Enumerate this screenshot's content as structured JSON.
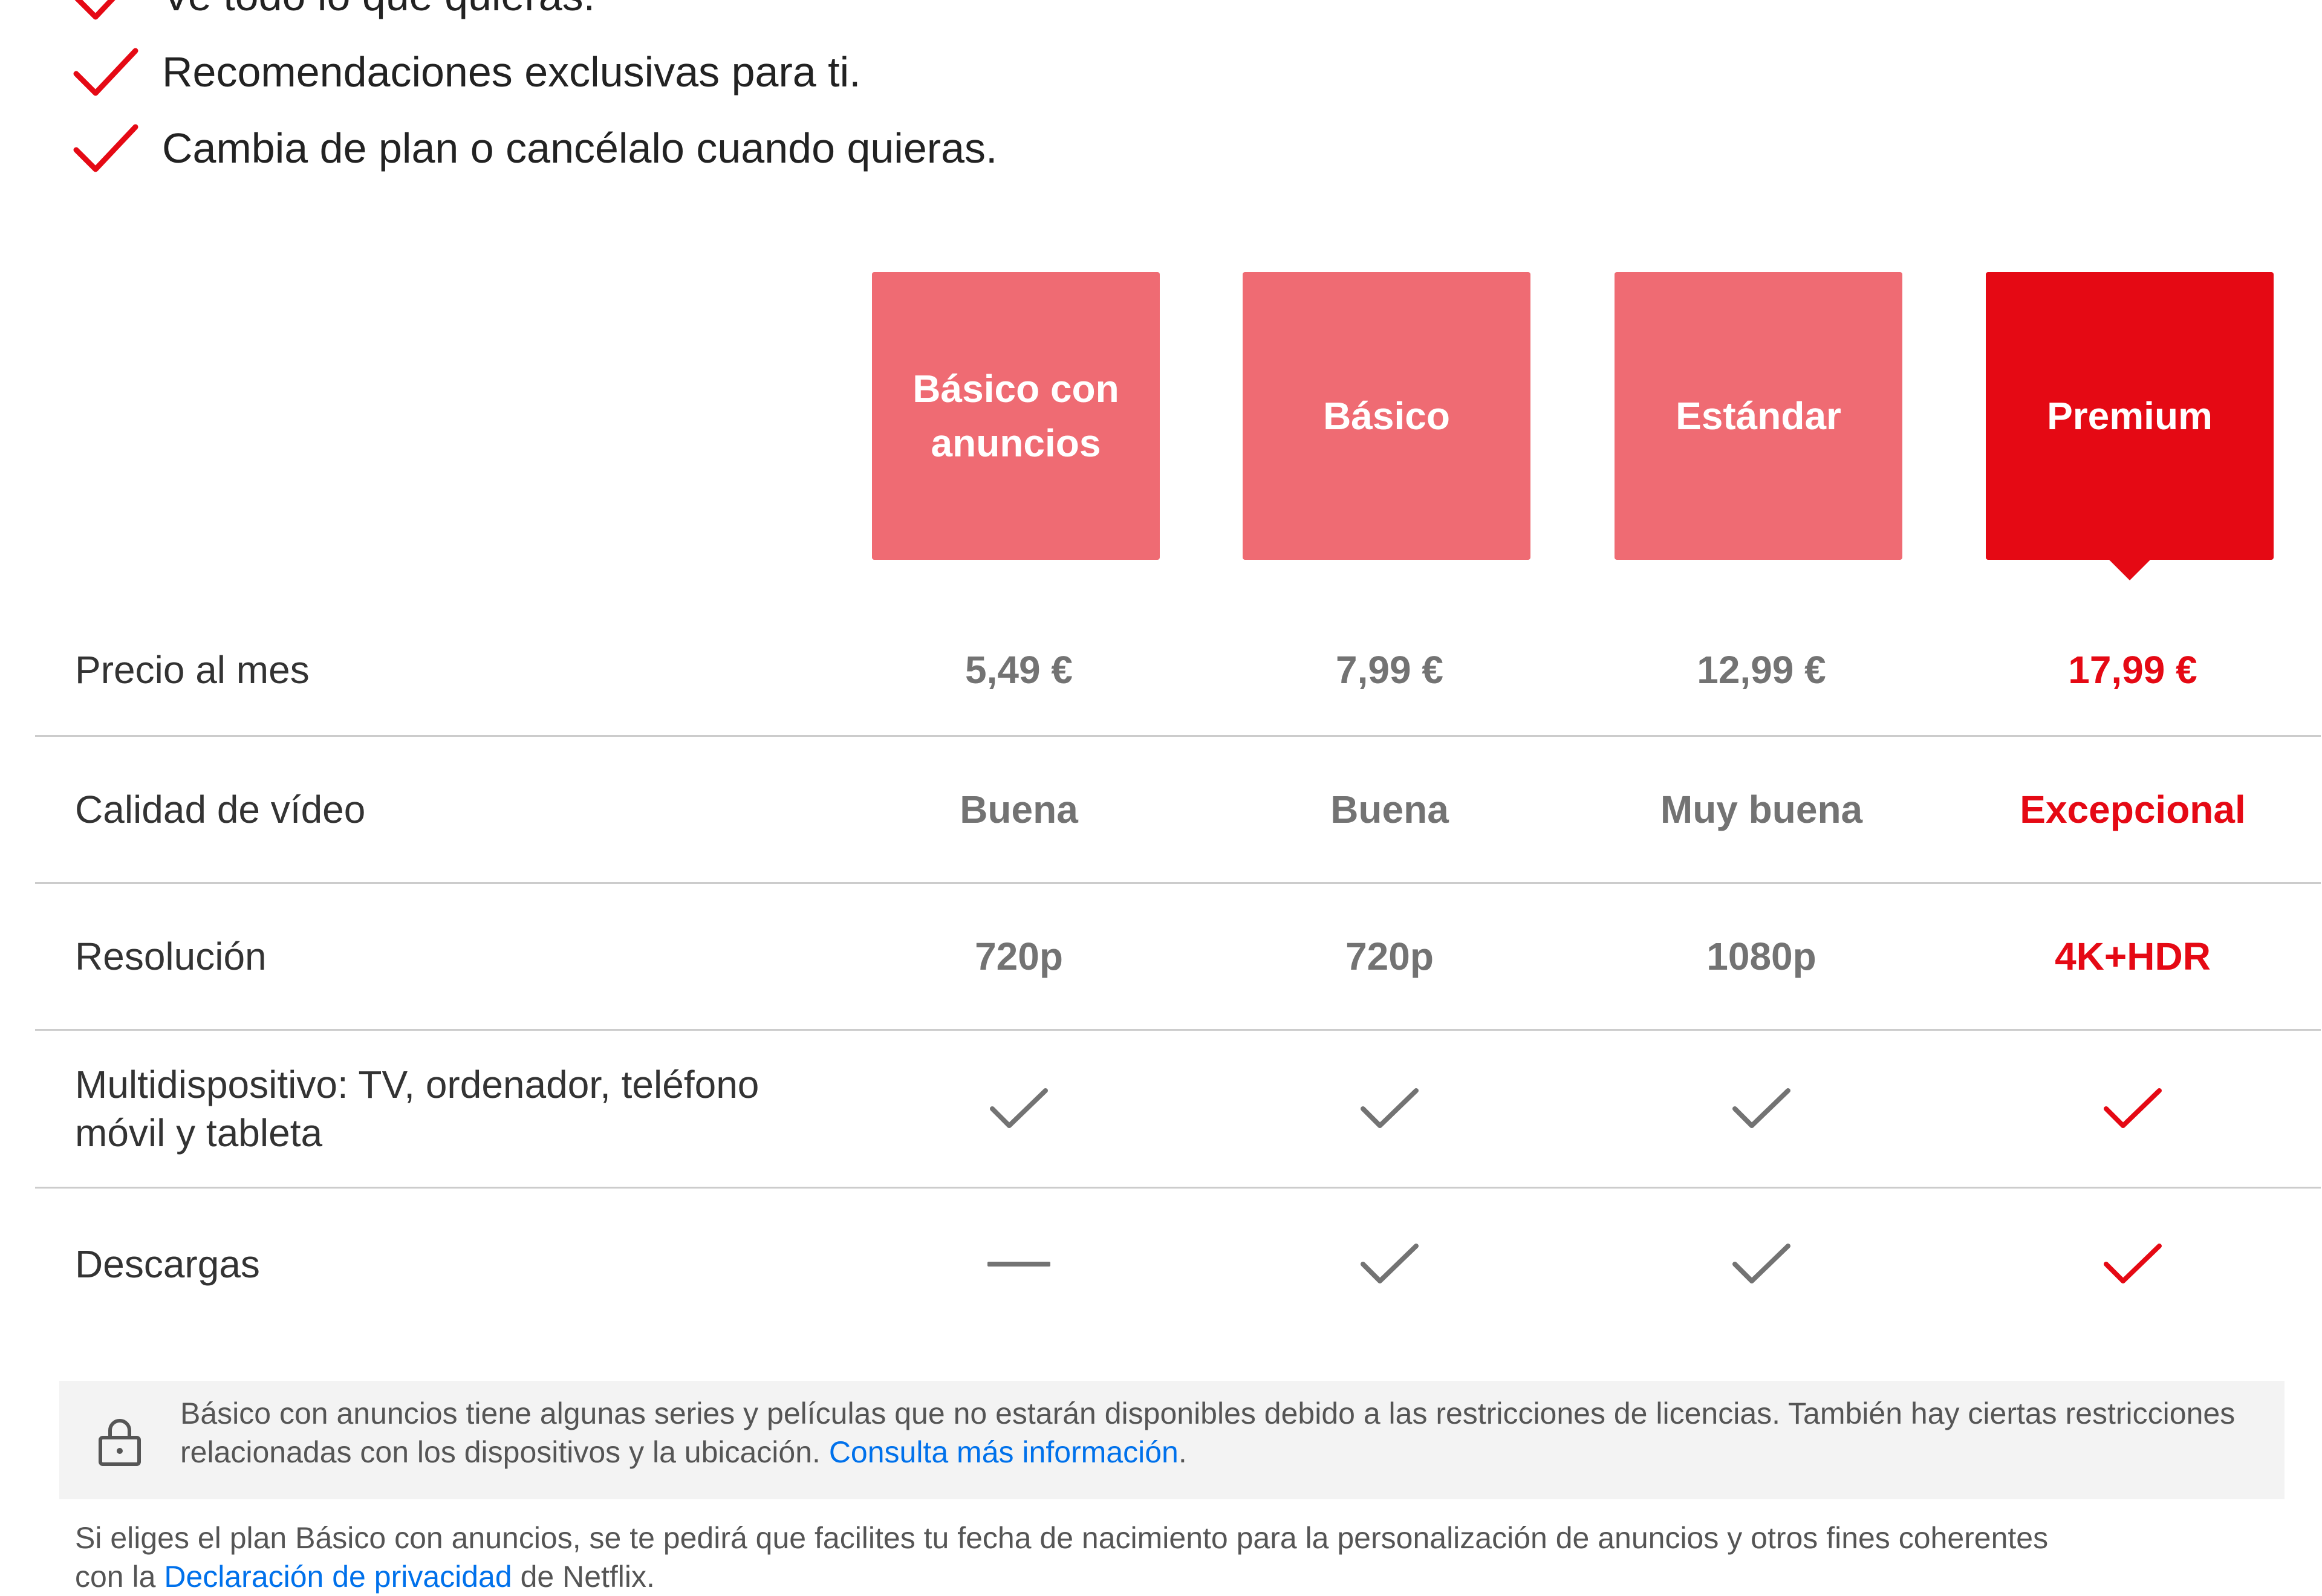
{
  "benefits": [
    "Ve todo lo que quieras.",
    "Recomendaciones exclusivas para ti.",
    "Cambia de plan o cancélalo cuando quieras."
  ],
  "plans": [
    {
      "name": "Básico con anuncios",
      "selected": false
    },
    {
      "name": "Básico",
      "selected": false
    },
    {
      "name": "Estándar",
      "selected": false
    },
    {
      "name": "Premium",
      "selected": true
    }
  ],
  "rows": {
    "price": {
      "label": "Precio al mes",
      "values": [
        "5,49 €",
        "7,99 €",
        "12,99 €",
        "17,99 €"
      ]
    },
    "quality": {
      "label": "Calidad de vídeo",
      "values": [
        "Buena",
        "Buena",
        "Muy buena",
        "Excepcional"
      ]
    },
    "resolution": {
      "label": "Resolución",
      "values": [
        "720p",
        "720p",
        "1080p",
        "4K+HDR"
      ]
    },
    "multidevice": {
      "label": "Multidispositivo: TV, ordenador, teléfono móvil y tableta",
      "values": [
        "check",
        "check",
        "check",
        "check"
      ]
    },
    "downloads": {
      "label": "Descargas",
      "values": [
        "dash",
        "check",
        "check",
        "check"
      ]
    }
  },
  "info_box": {
    "icon": "lock-icon",
    "text": "Básico con anuncios tiene algunas series y películas que no estarán disponibles debido a las restricciones de licencias. También hay ciertas restricciones relacionadas con los dispositivos y la ubicación.",
    "link": "Consulta más información",
    "end": "."
  },
  "footer": {
    "text_before": "Si eliges el plan Básico con anuncios, se te pedirá que facilites tu fecha de nacimiento para la personalización de anuncios y otros fines coherentes con la",
    "link": "Declaración de privacidad",
    "text_after": "de Netflix."
  },
  "colors": {
    "brand_red": "#e50914",
    "card_light": "#ef6b73",
    "neutral": "#737373",
    "link": "#0071eb"
  }
}
